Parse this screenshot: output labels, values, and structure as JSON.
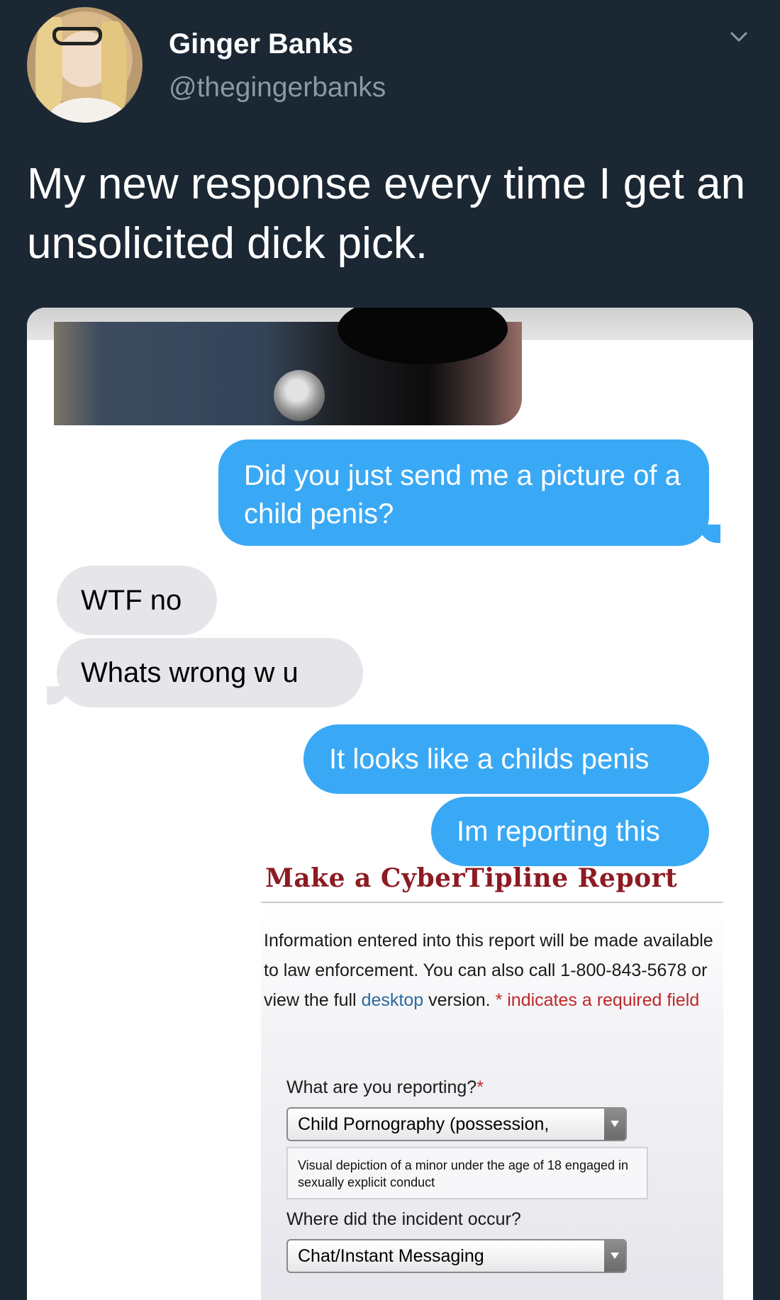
{
  "tweet": {
    "display_name": "Ginger Banks",
    "handle": "@thegingerbanks",
    "text": "My new response every time I get an unsolicited dick pick."
  },
  "icons": {
    "menu": "chevron-down-icon"
  },
  "messages": [
    {
      "from": "me",
      "text": "Did you just send me a picture of a child penis?"
    },
    {
      "from": "them",
      "text": "WTF no"
    },
    {
      "from": "them",
      "text": "Whats wrong w u"
    },
    {
      "from": "me",
      "text": "It looks like a childs penis"
    },
    {
      "from": "me",
      "text": "Im reporting this"
    }
  ],
  "cybertipline": {
    "title": "Make a CyberTipline Report",
    "intro_part1": "Information entered into this report will be made available to law enforcement. You can also call 1-800-843-5678 or view the full ",
    "intro_link": "desktop",
    "intro_part2": " version. ",
    "required_note": "* indicates a required field",
    "q1_label": "What are you reporting?",
    "q1_required_mark": "*",
    "q1_selected": "Child Pornography (possession,",
    "q1_hint": "Visual depiction of a minor under the age of 18 engaged in sexually explicit conduct",
    "q2_label": "Where did the incident occur?",
    "q2_selected": "Chat/Instant Messaging"
  },
  "colors": {
    "background": "#1b2733",
    "sent_bubble": "#3aa9f5",
    "received_bubble": "#e6e6ea",
    "title_red": "#8d1b22",
    "link_blue": "#2c6aa0",
    "required_red": "#c0262a"
  }
}
